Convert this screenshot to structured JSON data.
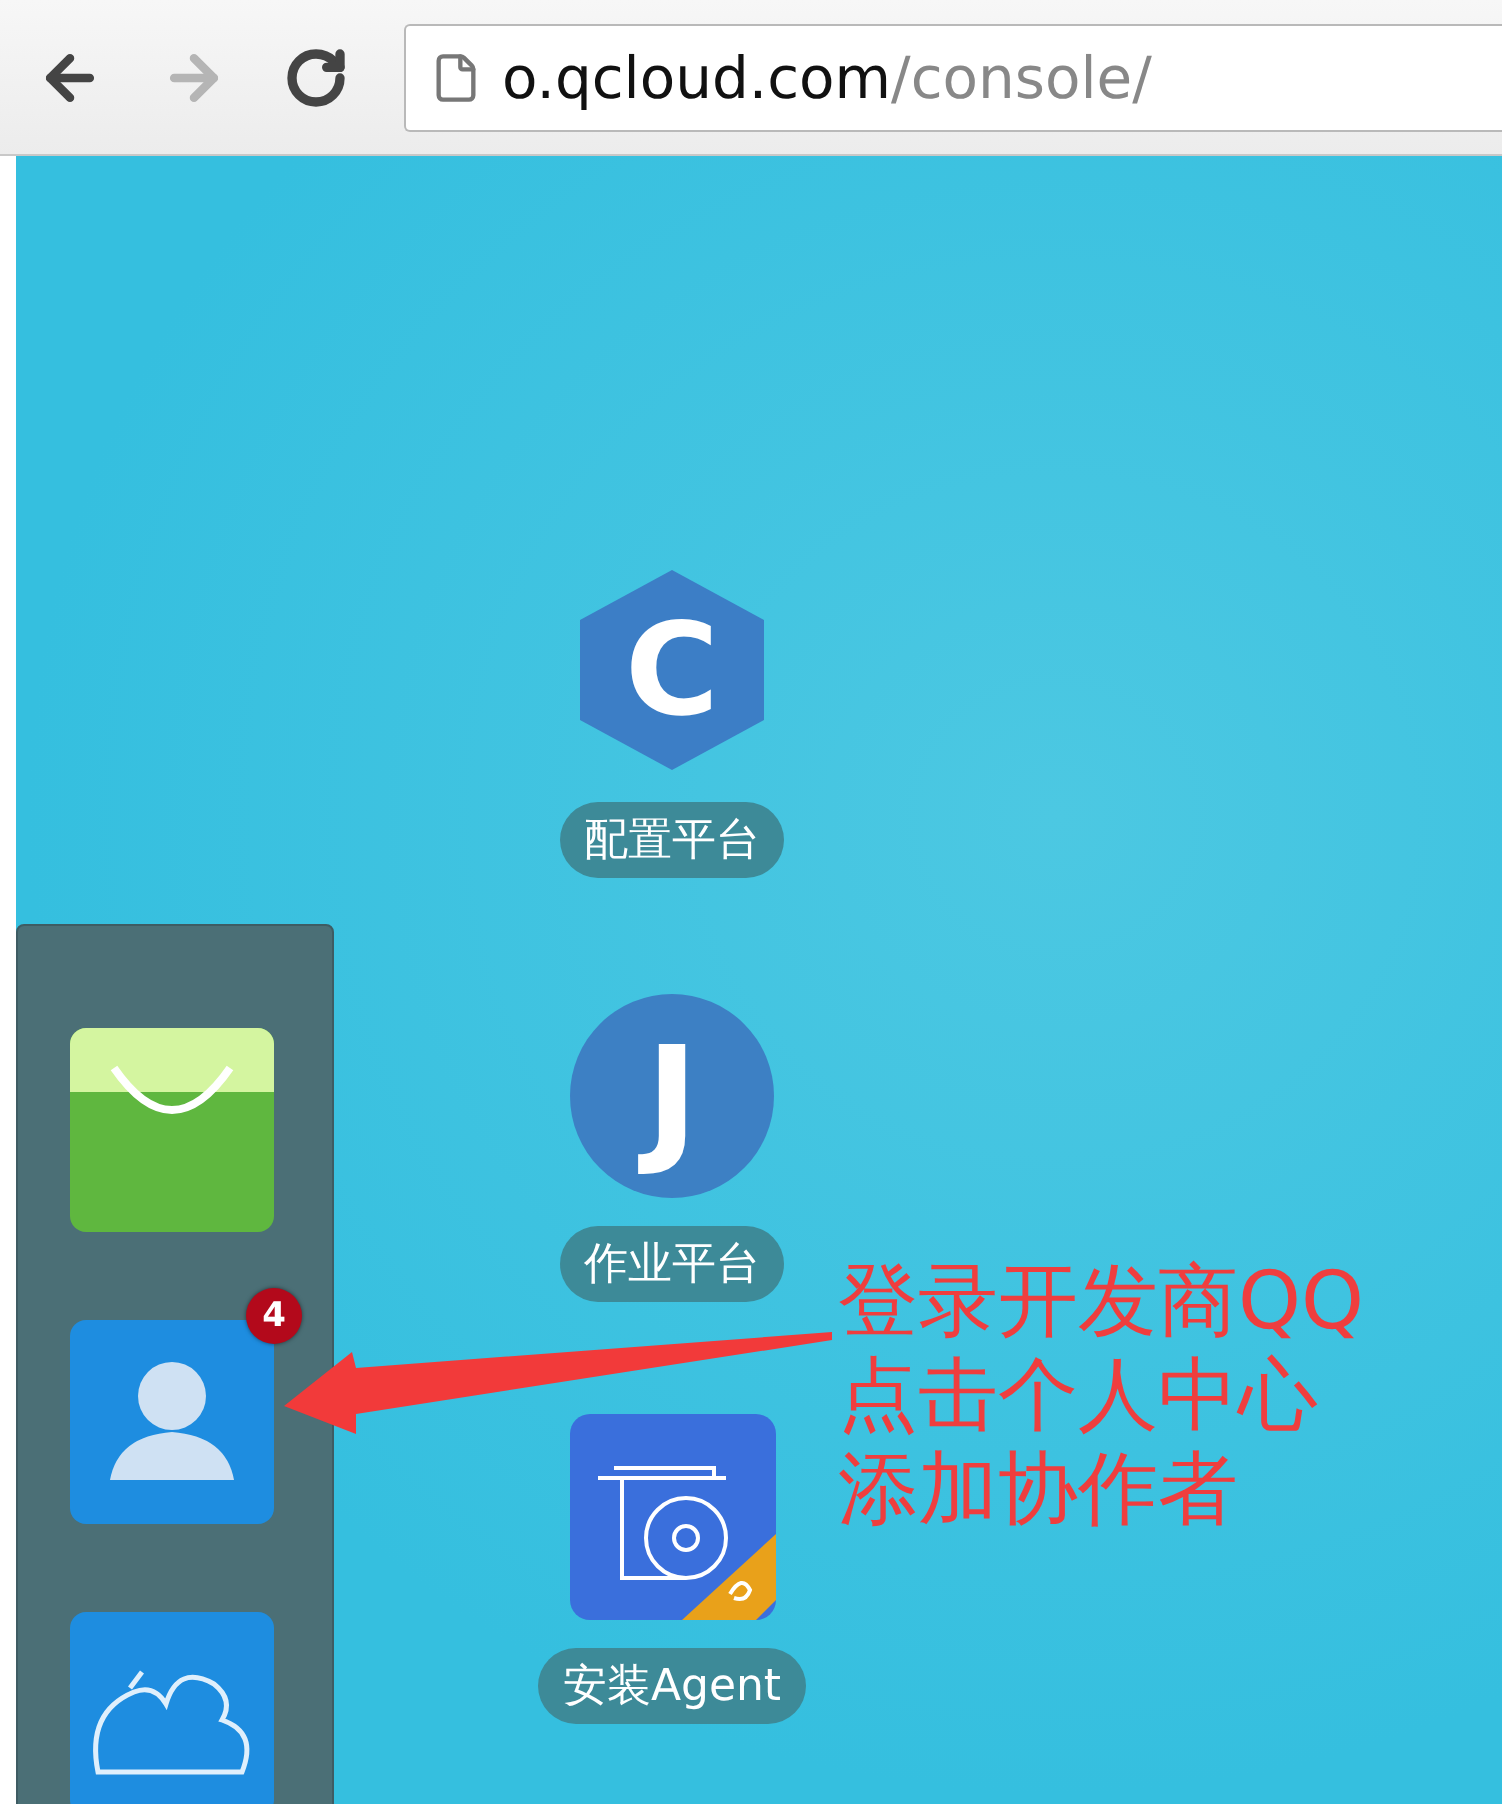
{
  "browser": {
    "url_host": "o.qcloud.com",
    "url_path": "/console/"
  },
  "apps": [
    {
      "kind": "hexagon",
      "glyph": "C",
      "label": "配置平台"
    },
    {
      "kind": "circle",
      "glyph": "J",
      "label": "作业平台"
    },
    {
      "kind": "installer",
      "label": "安装Agent"
    }
  ],
  "dock": [
    {
      "kind": "bag"
    },
    {
      "kind": "user",
      "badge": "4"
    },
    {
      "kind": "cloud"
    }
  ],
  "annotation": [
    "登录开发商QQ",
    "点击个人中心",
    "添加协作者"
  ]
}
